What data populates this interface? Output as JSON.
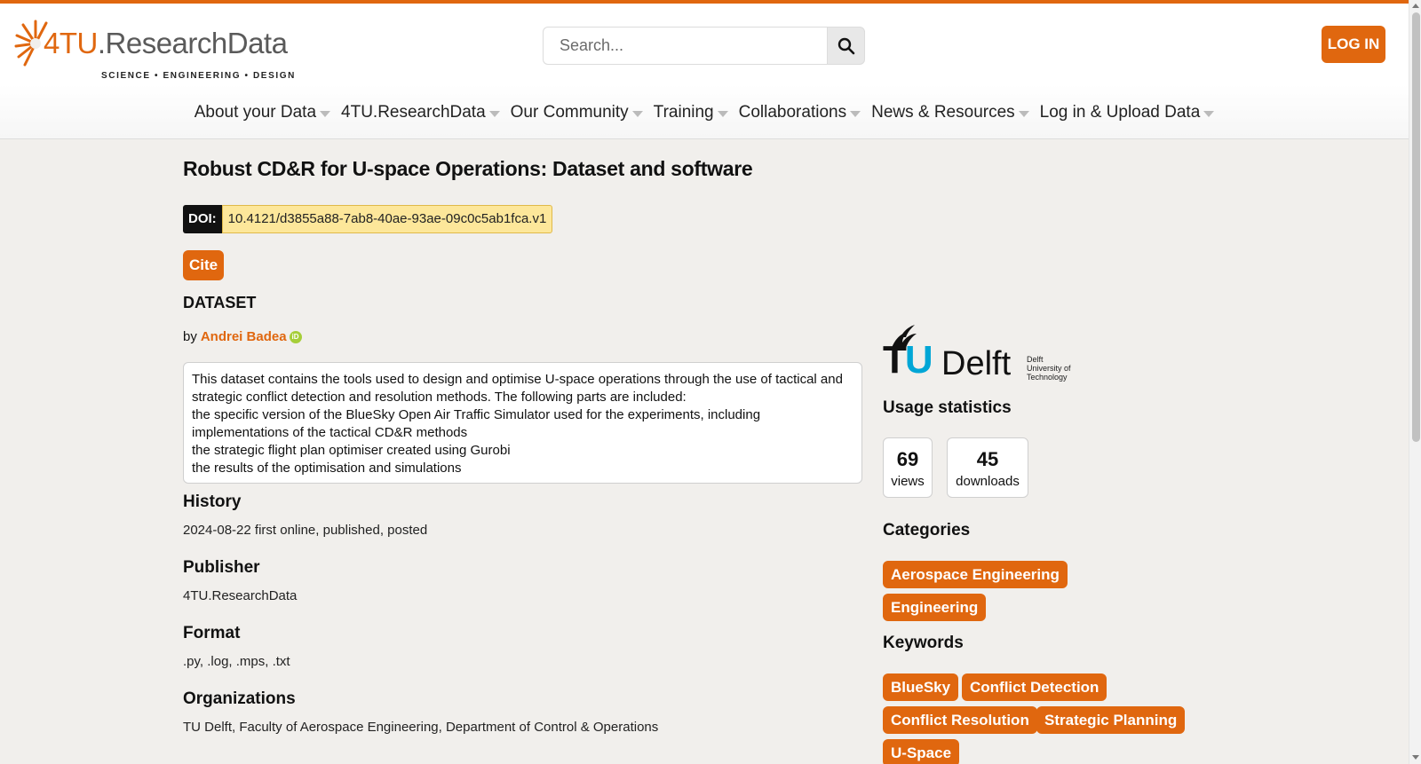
{
  "brand": {
    "name_accent": "4TU",
    "name_rest": ".ResearchData",
    "tagline": "SCIENCE • ENGINEERING • DESIGN",
    "accent_color": "#e0670f"
  },
  "search": {
    "placeholder": "Search...",
    "icon": "search-icon"
  },
  "header": {
    "login_label": "LOG IN"
  },
  "nav": [
    {
      "label": "About your Data"
    },
    {
      "label": "4TU.ResearchData"
    },
    {
      "label": "Our Community"
    },
    {
      "label": "Training"
    },
    {
      "label": "Collaborations"
    },
    {
      "label": "News & Resources"
    },
    {
      "label": "Log in & Upload Data"
    }
  ],
  "dataset": {
    "title": "Robust CD&R for U-space Operations: Dataset and software",
    "doi_label": "DOI:",
    "doi": "10.4121/d3855a88-7ab8-40ae-93ae-09c0c5ab1fca.v1",
    "cite_label": "Cite",
    "type": "DATASET",
    "by": "by",
    "author": "Andrei Badea",
    "description": [
      "This dataset contains the tools used to design and optimise U-space operations through the use of tactical and strategic conflict detection and resolution methods. The following parts are included:",
      "the specific version of the BlueSky Open Air Traffic Simulator used for the experiments, including implementations of the tactical CD&R methods",
      "the strategic flight plan optimiser created using Gurobi",
      "the results of the optimisation and simulations"
    ]
  },
  "sections": {
    "history": {
      "heading": "History",
      "value": "2024-08-22 first online, published, posted"
    },
    "publisher": {
      "heading": "Publisher",
      "value": "4TU.ResearchData"
    },
    "format": {
      "heading": "Format",
      "value": ".py, .log, .mps, .txt"
    },
    "organizations": {
      "heading": "Organizations",
      "value": "TU Delft, Faculty of Aerospace Engineering, Department of Control & Operations"
    }
  },
  "sidebar": {
    "institution_logo": {
      "tu": "TU",
      "delft": "Delft",
      "small_1": "Delft",
      "small_2": "University of",
      "small_3": "Technology"
    },
    "usage_heading": "Usage statistics",
    "views": {
      "value": "69",
      "label": "views"
    },
    "downloads": {
      "value": "45",
      "label": "downloads"
    },
    "categories_heading": "Categories",
    "categories": [
      "Aerospace Engineering",
      "Engineering"
    ],
    "keywords_heading": "Keywords",
    "keywords": [
      "BlueSky",
      "Conflict Detection",
      "Conflict Resolution",
      "Strategic Planning",
      "U-Space"
    ]
  }
}
